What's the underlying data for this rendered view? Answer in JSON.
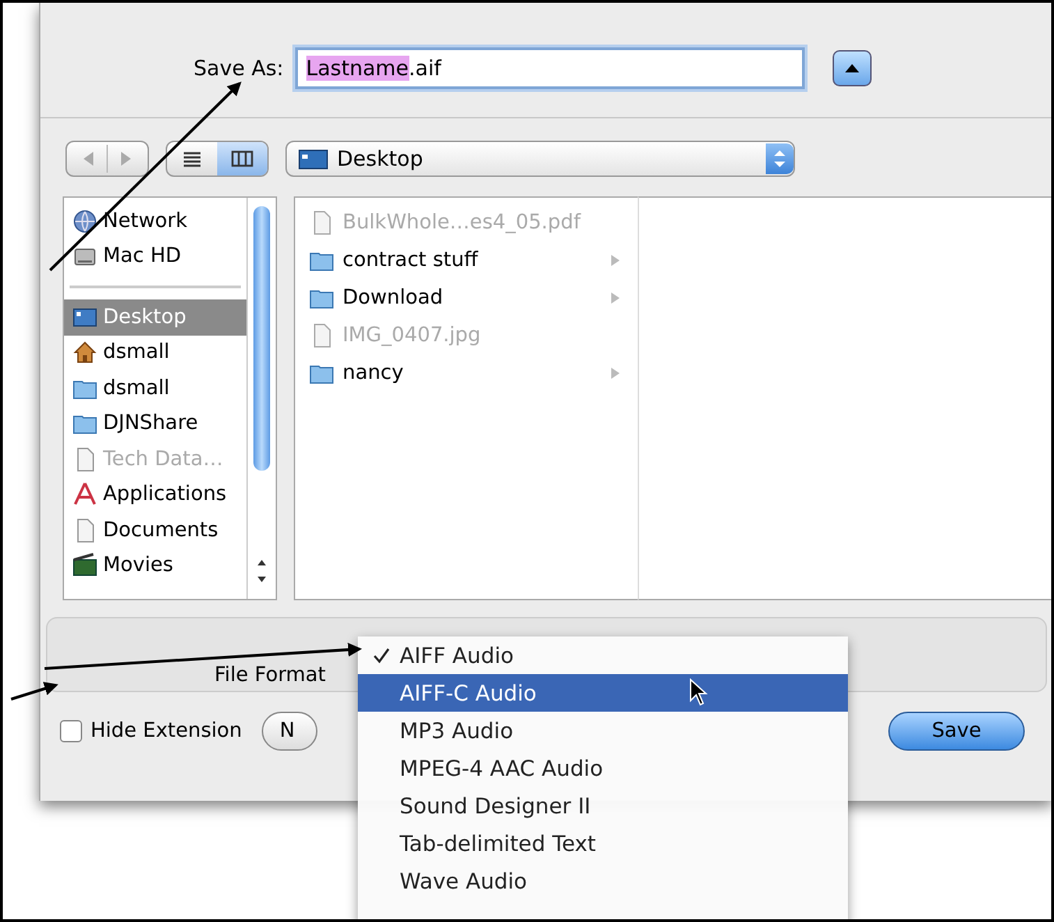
{
  "save_as": {
    "label": "Save As:",
    "value_selected": "Lastname",
    "value_rest": ".aif"
  },
  "location_popup": {
    "value": "Desktop"
  },
  "view_buttons": [
    {
      "kind": "list",
      "selected": false
    },
    {
      "kind": "columns",
      "selected": true
    }
  ],
  "sidebar": {
    "devices": [
      {
        "label": "Network",
        "kind": "network",
        "selected": false,
        "disabled": false
      },
      {
        "label": "Mac HD",
        "kind": "drive",
        "selected": false,
        "disabled": false
      }
    ],
    "places": [
      {
        "label": "Desktop",
        "kind": "desktop",
        "selected": true,
        "disabled": false
      },
      {
        "label": "dsmall",
        "kind": "home",
        "selected": false,
        "disabled": false
      },
      {
        "label": "dsmall",
        "kind": "folder",
        "selected": false,
        "disabled": false
      },
      {
        "label": "DJNShare",
        "kind": "folder",
        "selected": false,
        "disabled": false
      },
      {
        "label": "Tech Data…",
        "kind": "document",
        "selected": false,
        "disabled": true
      },
      {
        "label": "Applications",
        "kind": "apps",
        "selected": false,
        "disabled": false
      },
      {
        "label": "Documents",
        "kind": "document",
        "selected": false,
        "disabled": false
      },
      {
        "label": "Movies",
        "kind": "movies",
        "selected": false,
        "disabled": false
      }
    ]
  },
  "files": [
    {
      "name": "BulkWhole…es4_05.pdf",
      "kind": "document",
      "disabled": true,
      "has_children": false
    },
    {
      "name": "contract stuff",
      "kind": "folder",
      "disabled": false,
      "has_children": true
    },
    {
      "name": "Download",
      "kind": "folder",
      "disabled": false,
      "has_children": true
    },
    {
      "name": "IMG_0407.jpg",
      "kind": "document",
      "disabled": true,
      "has_children": false
    },
    {
      "name": "nancy",
      "kind": "folder",
      "disabled": false,
      "has_children": true
    }
  ],
  "file_format": {
    "label": "File Format"
  },
  "format_menu": {
    "items": [
      {
        "label": "AIFF Audio",
        "checked": true,
        "selected": false
      },
      {
        "label": "AIFF-C Audio",
        "checked": false,
        "selected": true
      },
      {
        "label": "MP3 Audio",
        "checked": false,
        "selected": false
      },
      {
        "label": "MPEG-4 AAC Audio",
        "checked": false,
        "selected": false
      },
      {
        "label": "Sound Designer II",
        "checked": false,
        "selected": false
      },
      {
        "label": "Tab-delimited Text",
        "checked": false,
        "selected": false
      },
      {
        "label": "Wave Audio",
        "checked": false,
        "selected": false
      }
    ]
  },
  "hide_extension": {
    "label": "Hide Extension",
    "checked": false
  },
  "new_folder_button": {
    "label": "N"
  },
  "save_button": {
    "label": "Save"
  }
}
